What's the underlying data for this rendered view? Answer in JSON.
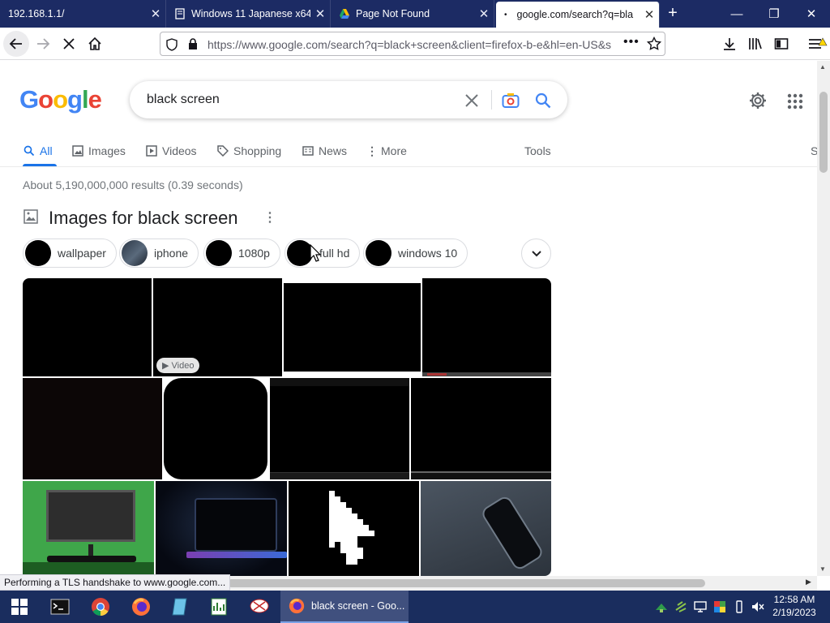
{
  "browser": {
    "tabs": [
      {
        "title": "192.168.1.1/"
      },
      {
        "title": "Windows 11 Japanese x64"
      },
      {
        "title": "Page Not Found"
      },
      {
        "title": "google.com/search?q=bla"
      }
    ],
    "url": "https://www.google.com/search?q=black+screen&client=firefox-b-e&hl=en-US&s",
    "status": "Performing a TLS handshake to www.google.com..."
  },
  "google": {
    "query": "black screen",
    "tabs": [
      {
        "label": "All",
        "icon": "search-icon"
      },
      {
        "label": "Images",
        "icon": "image-icon"
      },
      {
        "label": "Videos",
        "icon": "play-icon"
      },
      {
        "label": "Shopping",
        "icon": "tag-icon"
      },
      {
        "label": "News",
        "icon": "news-icon"
      },
      {
        "label": "More",
        "icon": "kebab-icon"
      }
    ],
    "tools_label": "Tools",
    "s_label": "S",
    "result_stats": "About 5,190,000,000 results (0.39 seconds)",
    "images_heading": "Images for black screen",
    "chips": [
      {
        "label": "wallpaper"
      },
      {
        "label": "iphone"
      },
      {
        "label": "1080p"
      },
      {
        "label": "full hd"
      },
      {
        "label": "windows 10"
      }
    ],
    "video_badge": "Video"
  },
  "taskbar": {
    "active_window": "black screen - Goo...",
    "time": "12:58 AM",
    "date": "2/19/2023"
  },
  "colors": {
    "accent": "#1a73e8",
    "titlebar": "#1c2b64",
    "taskbar": "#1a2d5e"
  }
}
